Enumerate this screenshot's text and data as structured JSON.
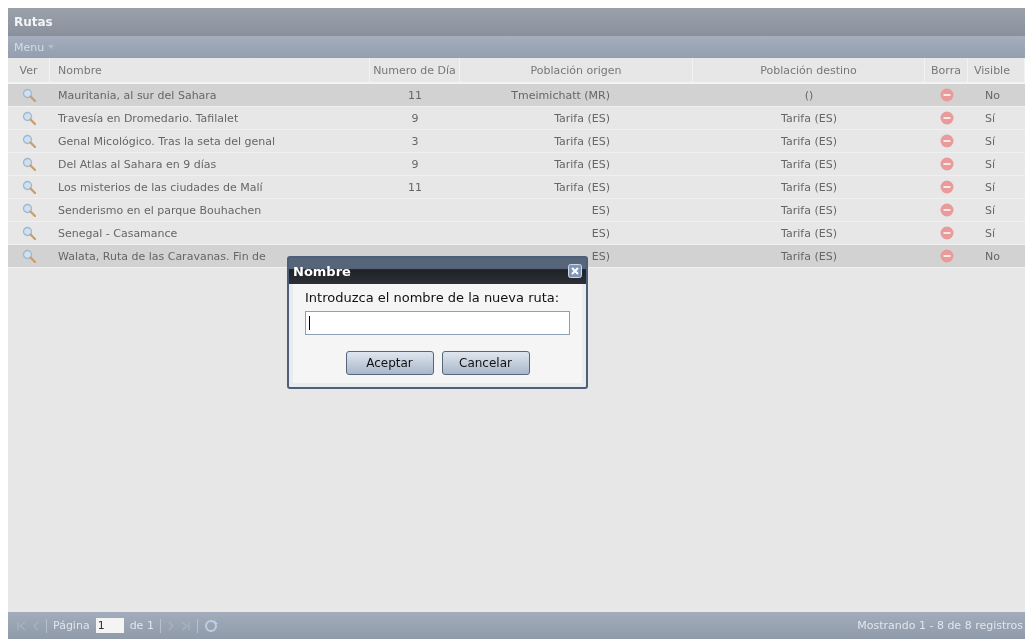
{
  "panel": {
    "title": "Rutas"
  },
  "menu": {
    "label": "Menu"
  },
  "table": {
    "columns": [
      "Ver",
      "Nombre",
      "Numero de Día",
      "Población origen",
      "Población destino",
      "Borra",
      "Visible"
    ],
    "rows": [
      {
        "selected": true,
        "name": "Mauritania, al sur del Sahara",
        "days": "11",
        "origin": "Tmeimichatt (MR)",
        "destination": "()",
        "visible": "No"
      },
      {
        "selected": false,
        "name": "Travesía en Dromedario. Tafilalet",
        "days": "9",
        "origin": "Tarifa (ES)",
        "destination": "Tarifa (ES)",
        "visible": "Sí"
      },
      {
        "selected": false,
        "name": "Genal Micológico. Tras la seta del genal",
        "days": "3",
        "origin": "Tarifa (ES)",
        "destination": "Tarifa (ES)",
        "visible": "Sí"
      },
      {
        "selected": false,
        "name": "Del Atlas al Sahara en 9 días",
        "days": "9",
        "origin": "Tarifa (ES)",
        "destination": "Tarifa (ES)",
        "visible": "Sí"
      },
      {
        "selected": false,
        "name": "Los misterios de las ciudades de Malí",
        "days": "11",
        "origin": "Tarifa (ES)",
        "destination": "Tarifa (ES)",
        "visible": "Sí"
      },
      {
        "selected": false,
        "name": "Senderismo en el parque Bouhachen",
        "origin": "ES)",
        "destination": "Tarifa (ES)",
        "visible": "Sí"
      },
      {
        "selected": false,
        "name": "Senegal - Casamance",
        "origin": "ES)",
        "destination": "Tarifa (ES)",
        "visible": "Sí"
      },
      {
        "selected": true,
        "name": "Walata, Ruta de las Caravanas. Fin de",
        "origin": "ES)",
        "destination": "Tarifa (ES)",
        "visible": "No"
      }
    ]
  },
  "dialog": {
    "title": "Nombre",
    "prompt": "Introduzca el nombre de la nueva ruta:",
    "buttons": [
      "Aceptar",
      "Cancelar"
    ]
  },
  "pager": {
    "page_label": "Página",
    "page": "1",
    "of_label": "de 1",
    "summary": "Mostrando 1 - 8 de 8 registros"
  }
}
